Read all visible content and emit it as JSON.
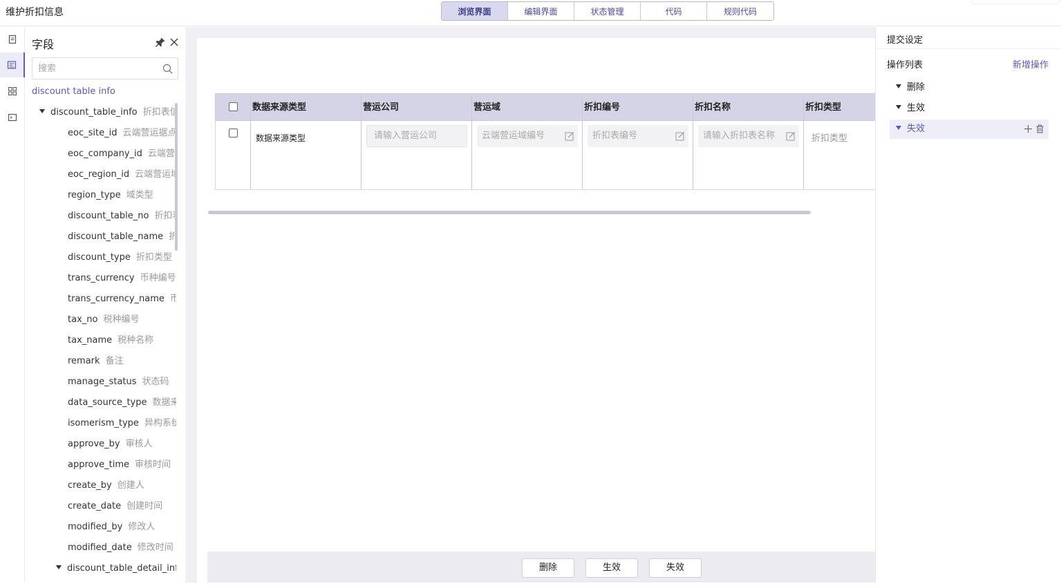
{
  "app": {
    "title": "维护折扣信息"
  },
  "view_tabs": [
    {
      "label": "浏览界面",
      "active": true
    },
    {
      "label": "编辑界面",
      "active": false
    },
    {
      "label": "状态管理",
      "active": false
    },
    {
      "label": "代码",
      "active": false
    },
    {
      "label": "规则代码",
      "active": false
    }
  ],
  "rail": {
    "icons": [
      "document-icon",
      "form-icon",
      "grid-icon",
      "terminal-icon"
    ],
    "active_index": 1
  },
  "fields_panel": {
    "title": "字段",
    "search_placeholder": "搜索",
    "root": "discount table info",
    "tree": [
      {
        "name": "discount_table_info",
        "label": "折扣表信息",
        "level": 1,
        "expanded": true
      },
      {
        "name": "eoc_site_id",
        "label": "云端营运据点",
        "level": 2
      },
      {
        "name": "eoc_company_id",
        "label": "云端营运公司",
        "level": 2
      },
      {
        "name": "eoc_region_id",
        "label": "云端营运域",
        "level": 2
      },
      {
        "name": "region_type",
        "label": "域类型",
        "level": 2
      },
      {
        "name": "discount_table_no",
        "label": "折扣表编号",
        "level": 2
      },
      {
        "name": "discount_table_name",
        "label": "折扣表名称",
        "level": 2
      },
      {
        "name": "discount_type",
        "label": "折扣类型",
        "level": 2
      },
      {
        "name": "trans_currency",
        "label": "币种编号",
        "level": 2
      },
      {
        "name": "trans_currency_name",
        "label": "币种名称",
        "level": 2
      },
      {
        "name": "tax_no",
        "label": "税种编号",
        "level": 2
      },
      {
        "name": "tax_name",
        "label": "税种名称",
        "level": 2
      },
      {
        "name": "remark",
        "label": "备注",
        "level": 2
      },
      {
        "name": "manage_status",
        "label": "状态码",
        "level": 2
      },
      {
        "name": "data_source_type",
        "label": "数据来源类型",
        "level": 2
      },
      {
        "name": "isomerism_type",
        "label": "异构系统",
        "level": 2
      },
      {
        "name": "approve_by",
        "label": "审核人",
        "level": 2
      },
      {
        "name": "approve_time",
        "label": "审核时间",
        "level": 2
      },
      {
        "name": "create_by",
        "label": "创建人",
        "level": 2
      },
      {
        "name": "create_date",
        "label": "创建时间",
        "level": 2
      },
      {
        "name": "modified_by",
        "label": "修改人",
        "level": 2
      },
      {
        "name": "modified_date",
        "label": "修改时间",
        "level": 2
      },
      {
        "name": "discount_table_detail_info",
        "label": "",
        "level": 2,
        "expanded": true
      }
    ]
  },
  "grid": {
    "columns": [
      "数据来源类型",
      "营运公司",
      "营运域",
      "折扣编号",
      "折扣名称",
      "折扣类型"
    ],
    "row": {
      "data_source_type": "数据来源类型",
      "company_placeholder": "请输入营运公司",
      "region_placeholder": "云端营运域编号",
      "discount_no_placeholder": "折扣表编号",
      "discount_name_placeholder": "请输入折扣表名称",
      "discount_type": "折扣类型"
    }
  },
  "footer_buttons": [
    "删除",
    "生效",
    "失效"
  ],
  "submit_panel": {
    "title": "提交设定",
    "op_list_label": "操作列表",
    "add_label": "新增操作",
    "ops": [
      {
        "label": "删除",
        "active": false
      },
      {
        "label": "生效",
        "active": false
      },
      {
        "label": "失效",
        "active": true
      }
    ]
  },
  "colors": {
    "accent": "#5a5ab8",
    "header_bg": "#d4d4e6",
    "tab_active": "#d8d8ee"
  }
}
